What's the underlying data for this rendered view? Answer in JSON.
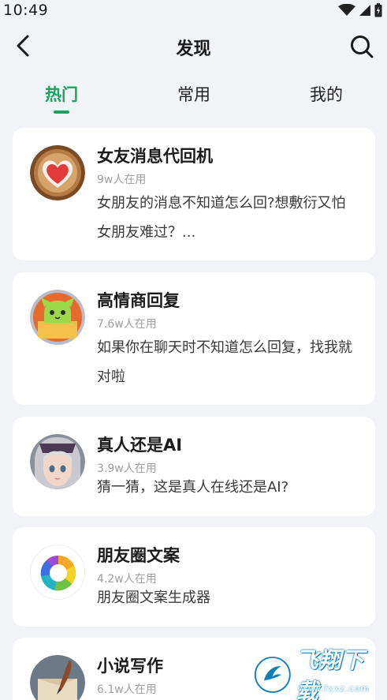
{
  "status_bar": {
    "time": "10:49"
  },
  "header": {
    "title": "发现"
  },
  "tabs": [
    {
      "label": "热门",
      "active": true
    },
    {
      "label": "常用",
      "active": false
    },
    {
      "label": "我的",
      "active": false
    }
  ],
  "items": [
    {
      "title": "女友消息代回机",
      "users": "9w人在用",
      "desc": "女朋友的消息不知道怎么回?想敷衍又怕女朋友难过？...",
      "avatar_icon": "heart-badge-icon"
    },
    {
      "title": "高情商回复",
      "users": "7.6w人在用",
      "desc": "如果你在聊天时不知道怎么回复，找我就对啦",
      "avatar_icon": "cat-bubble-icon"
    },
    {
      "title": "真人还是AI",
      "users": "3.9w人在用",
      "desc": "猜一猜，这是真人在线还是AI?",
      "avatar_icon": "anime-girl-avatar"
    },
    {
      "title": "朋友圈文案",
      "users": "4.2w人在用",
      "desc": "朋友圈文案生成器",
      "avatar_icon": "aperture-icon"
    },
    {
      "title": "小说写作",
      "users": "6.1w人在用",
      "desc": "",
      "avatar_icon": "book-quill-icon"
    }
  ],
  "watermark": {
    "text": "飞翔下载",
    "sub": "www.fxxz.com"
  },
  "colors": {
    "accent": "#1aa260",
    "background": "#f2f3f6",
    "card": "#ffffff"
  }
}
